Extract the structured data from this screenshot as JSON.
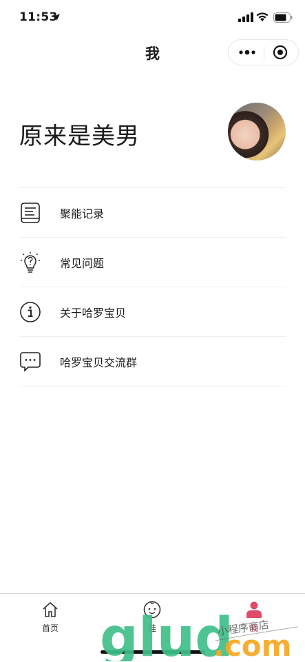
{
  "status_bar": {
    "time": "11:53"
  },
  "nav": {
    "title": "我"
  },
  "profile": {
    "name": "原来是美男"
  },
  "menu": [
    {
      "label": "聚能记录",
      "icon": "record-book-icon"
    },
    {
      "label": "常见问题",
      "icon": "lightbulb-question-icon"
    },
    {
      "label": "关于哈罗宝贝",
      "icon": "info-icon"
    },
    {
      "label": "哈罗宝贝交流群",
      "icon": "chat-bubble-icon"
    }
  ],
  "tabbar": {
    "home": "首页",
    "baby": "娃",
    "me": "我"
  },
  "watermark": {
    "brand": "glud",
    "domain": ".com",
    "tagline": "小程序商店"
  },
  "colors": {
    "active_tab": "#e04b6a",
    "watermark_green": "#3fbf8a",
    "watermark_orange": "#f5a623"
  }
}
